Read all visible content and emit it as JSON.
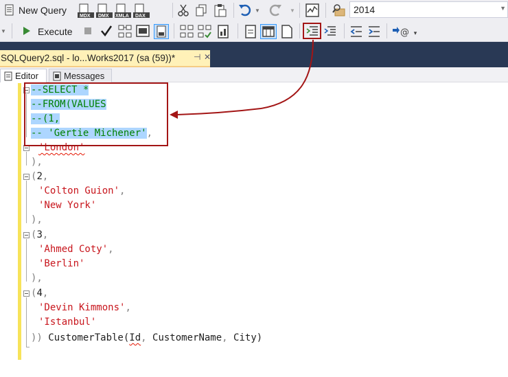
{
  "toolbar": {
    "new_query_label": "New Query",
    "execute_label": "Execute",
    "database_combo_value": "2014",
    "mdx_label": "MDX",
    "dmx_label": "DMX",
    "xmla_label": "XMLA",
    "dax_label": "DAX"
  },
  "document_tab": {
    "title": "SQLQuery2.sql - lo...Works2017 (sa (59))*",
    "pin_glyph": "⊣",
    "close_glyph": "✕"
  },
  "sub_tabs": [
    {
      "label": "Editor"
    },
    {
      "label": "Messages"
    }
  ],
  "editor": {
    "lines": [
      {
        "a": "--SELECT *"
      },
      {
        "a": "--FROM(VALUES"
      },
      {
        "a": "--(1,"
      },
      {
        "a": "-- 'Gertie Michener'",
        "b": ","
      },
      {
        "a": "'London'"
      },
      {
        "a": "),"
      },
      {
        "a": "(",
        "b": "2",
        "c": ","
      },
      {
        "a": "'Colton Guion'",
        "b": ","
      },
      {
        "a": "'New York'"
      },
      {
        "a": "),"
      },
      {
        "a": "(",
        "b": "3",
        "c": ","
      },
      {
        "a": "'Ahmed Coty'",
        "b": ","
      },
      {
        "a": "'Berlin'"
      },
      {
        "a": "),"
      },
      {
        "a": "(",
        "b": "4",
        "c": ","
      },
      {
        "a": "'Devin Kimmons'",
        "b": ","
      },
      {
        "a": "'Istanbul'"
      },
      {
        "a": "))",
        "b": " CustomerTable(",
        "c": "Id",
        "d": ",",
        "e": " CustomerName",
        "f": ",",
        "g": " City",
        "h": ")"
      }
    ]
  },
  "colors": {
    "accent_annotation": "#a31515",
    "doc_strip": "#293955",
    "active_tab": "#fff1b8",
    "selection": "#add6ff",
    "comment": "#008000",
    "string": "#c8151c"
  }
}
